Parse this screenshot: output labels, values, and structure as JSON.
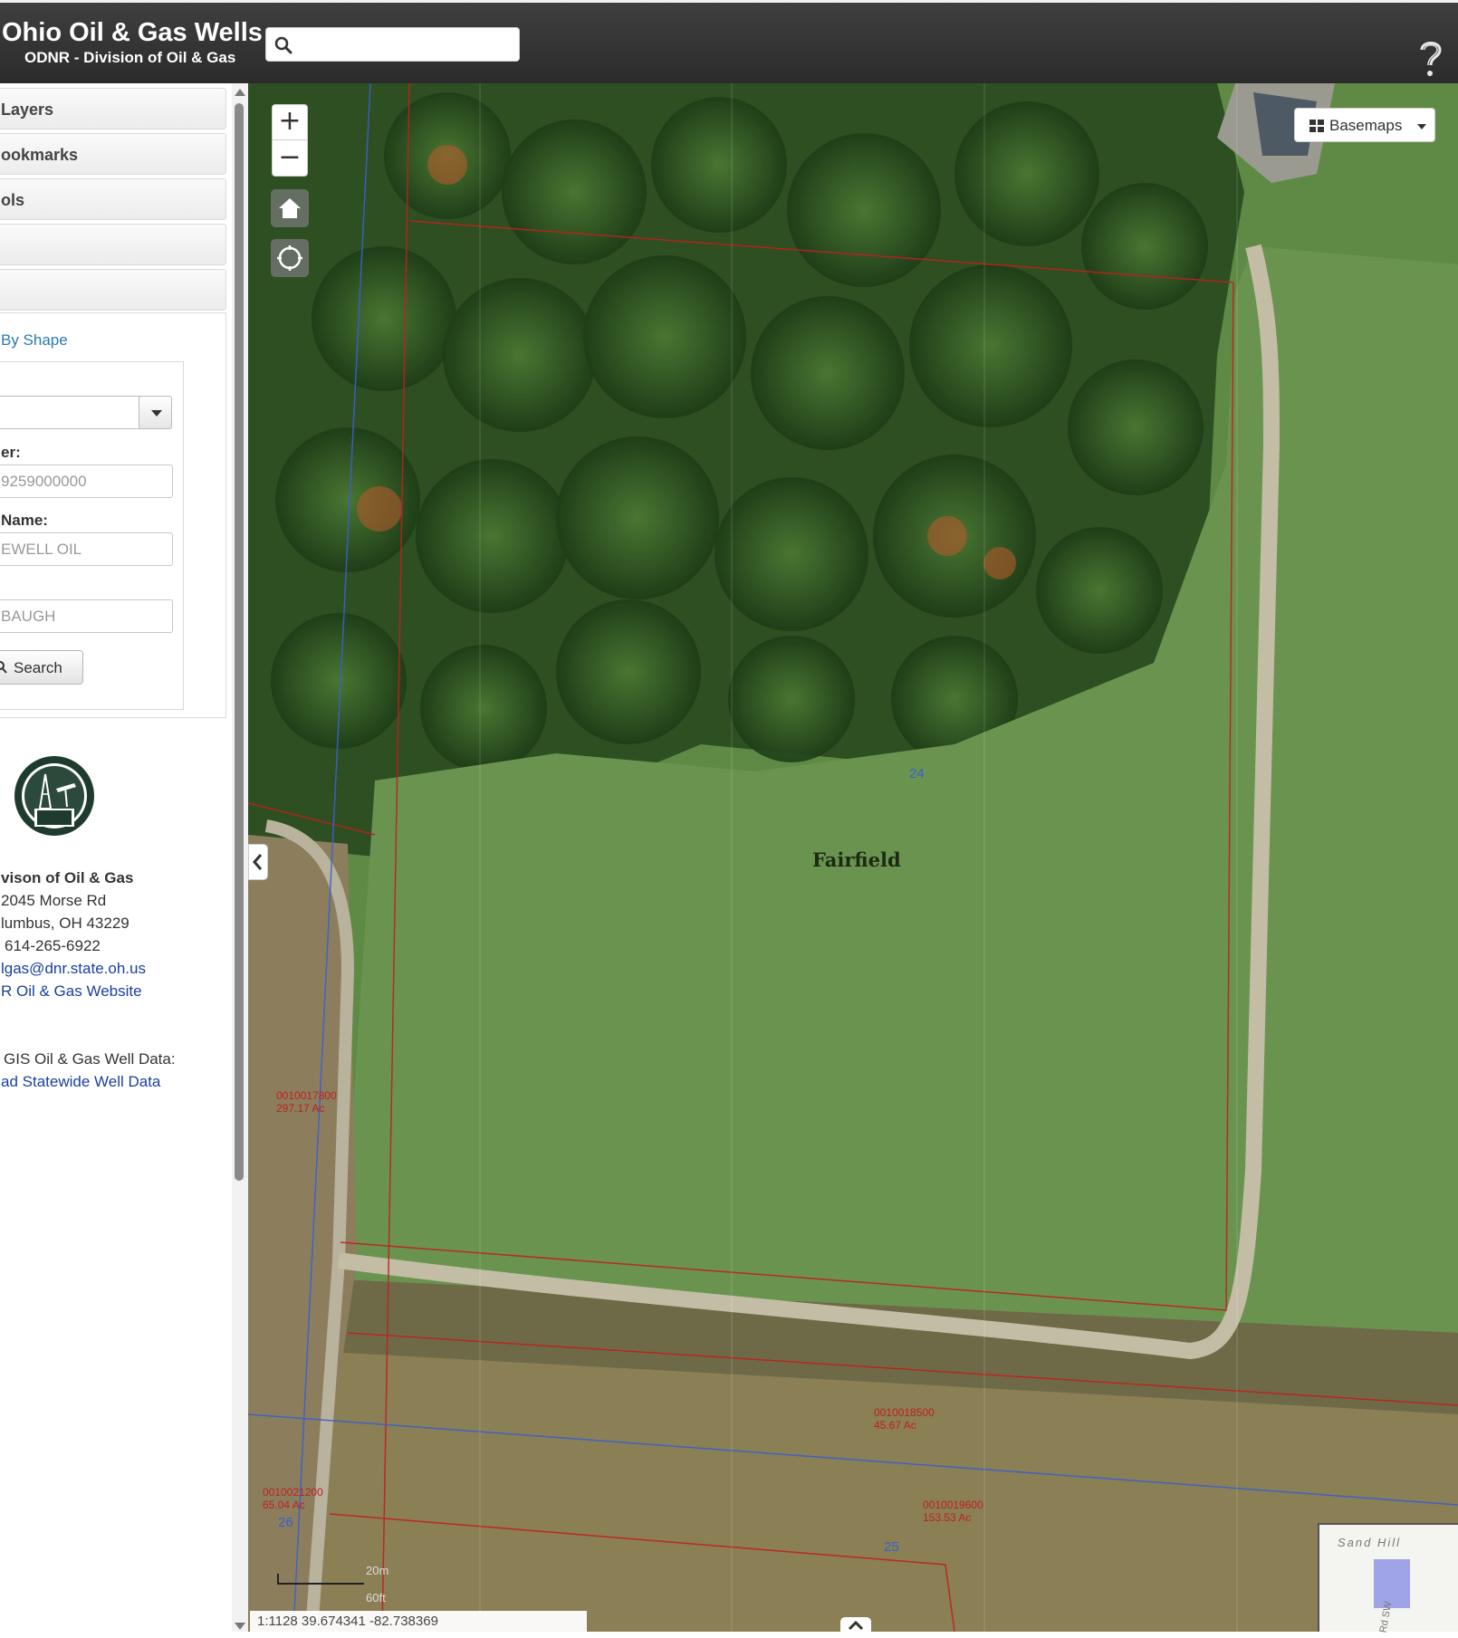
{
  "header": {
    "title": "Ohio Oil & Gas Wells",
    "subtitle": "ODNR - Division of Oil & Gas",
    "search_placeholder": ""
  },
  "sidebar": {
    "accordion": [
      {
        "label": "Layers"
      },
      {
        "label": "ookmarks"
      },
      {
        "label": "ols"
      },
      {
        "label": ""
      },
      {
        "label": ""
      }
    ],
    "shape_link": "By Shape",
    "form": {
      "select_value": "",
      "field1_label": "er:",
      "field1_value": "9259000000",
      "field2_label": "Name:",
      "field2_value": "EWELL OIL",
      "field3_value": "BAUGH",
      "search_button": "Search"
    },
    "contact": {
      "org": "vison of Oil & Gas",
      "address1": "2045 Morse Rd",
      "address2": "lumbus, OH 43229",
      "phone": "614-265-6922",
      "email": "lgas@dnr.state.oh.us",
      "website": "R Oil & Gas Website",
      "gis_label": "GIS Oil & Gas Well Data:",
      "gis_link": "ad Statewide Well Data"
    }
  },
  "map": {
    "basemaps_label": "Basemaps",
    "place_label": "Fairfield",
    "parcels": [
      {
        "id": "0010017800",
        "area": "297.17 Ac"
      },
      {
        "id": "0010018500",
        "area": "45.67 Ac"
      },
      {
        "id": "0010021200",
        "area": "65.04 Ac"
      },
      {
        "id": "0010019600",
        "area": "153.53 Ac"
      }
    ],
    "sections": [
      "24",
      "26",
      "25"
    ],
    "scale": {
      "meters": "20m",
      "feet": "60ft"
    },
    "status": "1:1128  39.674341  -82.738369",
    "overview": {
      "label": "Sand Hill",
      "road": "Rd SW"
    }
  },
  "colors": {
    "header_bg": "#2f2f2f",
    "link": "#2a7ab0",
    "parcel_line": "#c02020",
    "section_line": "#3a5fd0"
  }
}
